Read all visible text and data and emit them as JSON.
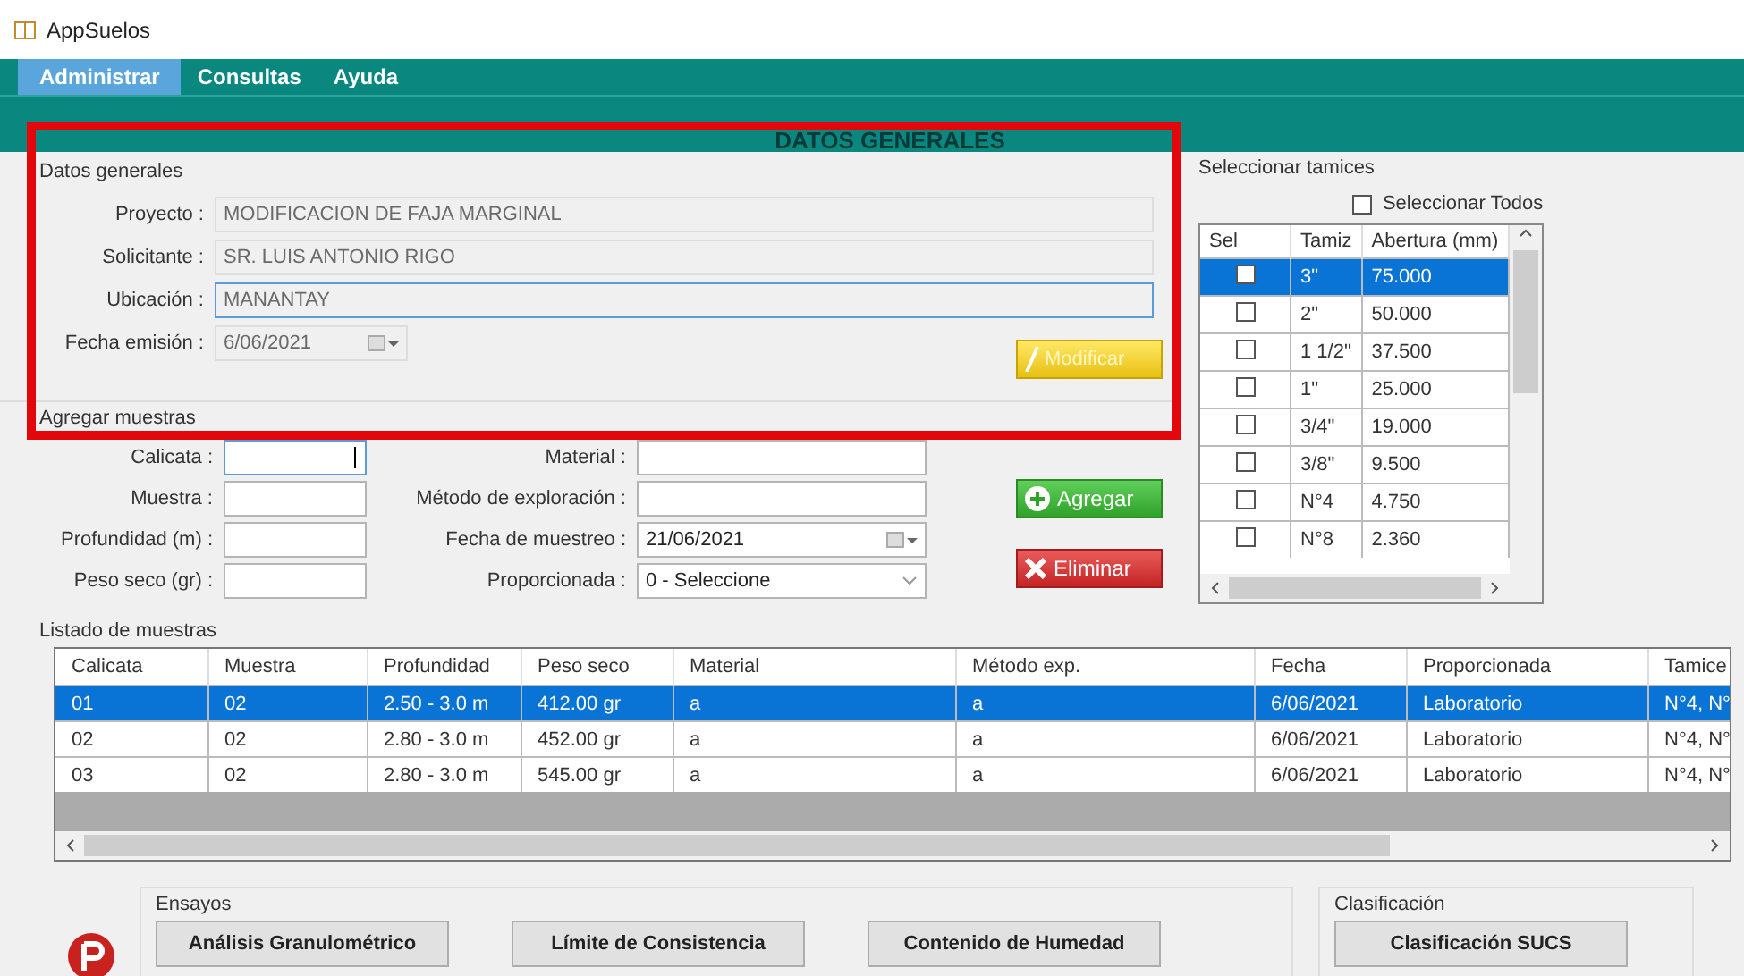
{
  "window": {
    "title": "AppSuelos"
  },
  "menu": [
    {
      "label": "Administrar",
      "selected": true
    },
    {
      "label": "Consultas",
      "selected": false
    },
    {
      "label": "Ayuda",
      "selected": false
    }
  ],
  "panel_title": "DATOS GENERALES",
  "general": {
    "title": "Datos generales",
    "fields": [
      {
        "label": "Proyecto :",
        "value": "MODIFICACION DE FAJA MARGINAL",
        "kind": "text",
        "disabled": true,
        "focused": false
      },
      {
        "label": "Solicitante :",
        "value": "SR. LUIS ANTONIO RIGO",
        "kind": "text",
        "disabled": true,
        "focused": false
      },
      {
        "label": "Ubicación :",
        "value": "MANANTAY",
        "kind": "text",
        "disabled": true,
        "focused": true
      },
      {
        "label": "Fecha emisión :",
        "value": "6/06/2021",
        "kind": "date",
        "disabled": true,
        "focused": false
      }
    ],
    "button": "Modificar"
  },
  "samples": {
    "title": "Agregar muestras",
    "fields": [
      {
        "label": "Calicata :",
        "kind": "text",
        "focused": true
      },
      {
        "label": "Material :",
        "kind": "text",
        "focused": false
      },
      {
        "label": "Muestra :",
        "kind": "text",
        "focused": false
      },
      {
        "label": "Método de exploración :",
        "kind": "text",
        "focused": false
      },
      {
        "label": "Profundidad (m) :",
        "kind": "text",
        "focused": false
      },
      {
        "label": "Fecha de muestreo :",
        "value": "21/06/2021",
        "kind": "date",
        "focused": false
      },
      {
        "label": "Peso seco (gr) :",
        "kind": "text",
        "focused": false
      },
      {
        "label": "Proporcionada :",
        "value": "0 - Seleccione",
        "kind": "select",
        "focused": false
      }
    ],
    "buttons": [
      {
        "label": "Agregar",
        "kind": "add"
      },
      {
        "label": "Eliminar",
        "kind": "delete"
      }
    ]
  },
  "sieves": {
    "title": "Seleccionar tamices",
    "select_all": {
      "label": "Seleccionar Todos",
      "checked": false
    },
    "columns": [
      "Sel",
      "Tamiz",
      "Abertura (mm)"
    ],
    "rows": [
      {
        "tamiz": "3\"",
        "abertura": "75.000",
        "checked": false,
        "selected": true
      },
      {
        "tamiz": "2\"",
        "abertura": "50.000",
        "checked": false,
        "selected": false
      },
      {
        "tamiz": "1 1/2\"",
        "abertura": "37.500",
        "checked": false,
        "selected": false
      },
      {
        "tamiz": "1\"",
        "abertura": "25.000",
        "checked": false,
        "selected": false
      },
      {
        "tamiz": "3/4\"",
        "abertura": "19.000",
        "checked": false,
        "selected": false
      },
      {
        "tamiz": "3/8\"",
        "abertura": "9.500",
        "checked": false,
        "selected": false
      },
      {
        "tamiz": "N°4",
        "abertura": "4.750",
        "checked": false,
        "selected": false
      },
      {
        "tamiz": "N°8",
        "abertura": "2.360",
        "checked": false,
        "selected": false
      }
    ]
  },
  "list": {
    "title": "Listado de muestras",
    "columns": [
      "Calicata",
      "Muestra",
      "Profundidad",
      "Peso seco",
      "Material",
      "Método exp.",
      "Fecha",
      "Proporcionada",
      "Tamice"
    ],
    "rows": [
      {
        "cells": [
          "01",
          "02",
          "2.50 - 3.0 m",
          "412.00 gr",
          "a",
          "a",
          "6/06/2021",
          "Laboratorio",
          "N°4, N°"
        ],
        "selected": true
      },
      {
        "cells": [
          "02",
          "02",
          "2.80 - 3.0 m",
          "452.00 gr",
          "a",
          "a",
          "6/06/2021",
          "Laboratorio",
          "N°4, N°"
        ],
        "selected": false
      },
      {
        "cells": [
          "03",
          "02",
          "2.80 - 3.0 m",
          "545.00 gr",
          "a",
          "a",
          "6/06/2021",
          "Laboratorio",
          "N°4, N°"
        ],
        "selected": false
      }
    ]
  },
  "tests": {
    "title": "Ensayos",
    "buttons": [
      "Análisis Granulométrico",
      "Límite de Consistencia",
      "Contenido de Humedad"
    ]
  },
  "classification": {
    "title": "Clasificación",
    "button": "Clasificación SUCS"
  }
}
